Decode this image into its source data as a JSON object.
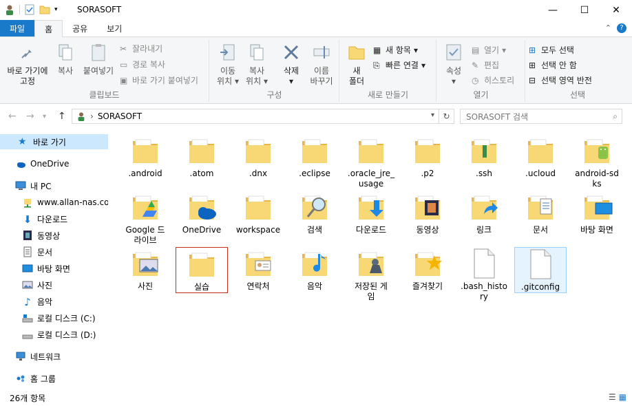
{
  "window": {
    "title": "SORASOFT"
  },
  "tabs": [
    {
      "label": "파일"
    },
    {
      "label": "홈"
    },
    {
      "label": "공유"
    },
    {
      "label": "보기"
    }
  ],
  "ribbon": {
    "clipboard": {
      "label": "클립보드",
      "pin_line1": "바로 가기에",
      "pin_line2": "고정",
      "copy": "복사",
      "paste": "붙여넣기",
      "cut": "잘라내기",
      "copy_path": "경로 복사",
      "paste_shortcut": "바로 가기 붙여넣기"
    },
    "organize": {
      "label": "구성",
      "move_line1": "이동",
      "move_line2": "위치",
      "copy_line1": "복사",
      "copy_line2": "위치",
      "delete": "삭제",
      "rename_line1": "이름",
      "rename_line2": "바꾸기"
    },
    "new": {
      "label": "새로 만들기",
      "folder_line1": "새",
      "folder_line2": "폴더",
      "new_item": "새 항목",
      "easy_access": "빠른 연결"
    },
    "open": {
      "label": "열기",
      "properties": "속성",
      "open": "열기",
      "edit": "편집",
      "history": "히스토리"
    },
    "select": {
      "label": "선택",
      "select_all": "모두 선택",
      "select_none": "선택 안 함",
      "invert": "선택 영역 반전"
    }
  },
  "address": {
    "path": "SORASOFT",
    "search_placeholder": "SORASOFT 검색"
  },
  "sidebar": {
    "items": [
      {
        "label": "바로 가기"
      },
      {
        "label": "OneDrive"
      },
      {
        "label": "내 PC"
      },
      {
        "label": "www.allan-nas.com"
      },
      {
        "label": "다운로드"
      },
      {
        "label": "동영상"
      },
      {
        "label": "문서"
      },
      {
        "label": "바탕 화면"
      },
      {
        "label": "사진"
      },
      {
        "label": "음악"
      },
      {
        "label": "로컬 디스크 (C:)"
      },
      {
        "label": "로컬 디스크 (D:)"
      },
      {
        "label": "네트워크"
      },
      {
        "label": "홈 그룹"
      }
    ]
  },
  "files": [
    {
      "line1": ".android",
      "line2": ""
    },
    {
      "line1": ".atom",
      "line2": ""
    },
    {
      "line1": ".dnx",
      "line2": ""
    },
    {
      "line1": ".eclipse",
      "line2": ""
    },
    {
      "line1": ".oracle_jre_",
      "line2": "usage"
    },
    {
      "line1": ".p2",
      "line2": ""
    },
    {
      "line1": ".ssh",
      "line2": ""
    },
    {
      "line1": ".ucloud",
      "line2": ""
    },
    {
      "line1": "android-sd",
      "line2": "ks"
    },
    {
      "line1": "Google 드",
      "line2": "라이브"
    },
    {
      "line1": "OneDrive",
      "line2": ""
    },
    {
      "line1": "workspace",
      "line2": ""
    },
    {
      "line1": "검색",
      "line2": ""
    },
    {
      "line1": "다운로드",
      "line2": ""
    },
    {
      "line1": "동영상",
      "line2": ""
    },
    {
      "line1": "링크",
      "line2": ""
    },
    {
      "line1": "문서",
      "line2": ""
    },
    {
      "line1": "바탕 화면",
      "line2": ""
    },
    {
      "line1": "사진",
      "line2": ""
    },
    {
      "line1": "실습",
      "line2": ""
    },
    {
      "line1": "연락처",
      "line2": ""
    },
    {
      "line1": "음악",
      "line2": ""
    },
    {
      "line1": "저장된 게",
      "line2": "임"
    },
    {
      "line1": "즐겨찾기",
      "line2": ""
    },
    {
      "line1": ".bash_histo",
      "line2": "ry"
    },
    {
      "line1": ".gitconfig",
      "line2": ""
    }
  ],
  "status": {
    "count": "26개 항목"
  },
  "colors": {
    "accent": "#1979ca",
    "folder": "#f8d775",
    "folder_dark": "#e8b64a",
    "selected": "#cce8ff"
  }
}
